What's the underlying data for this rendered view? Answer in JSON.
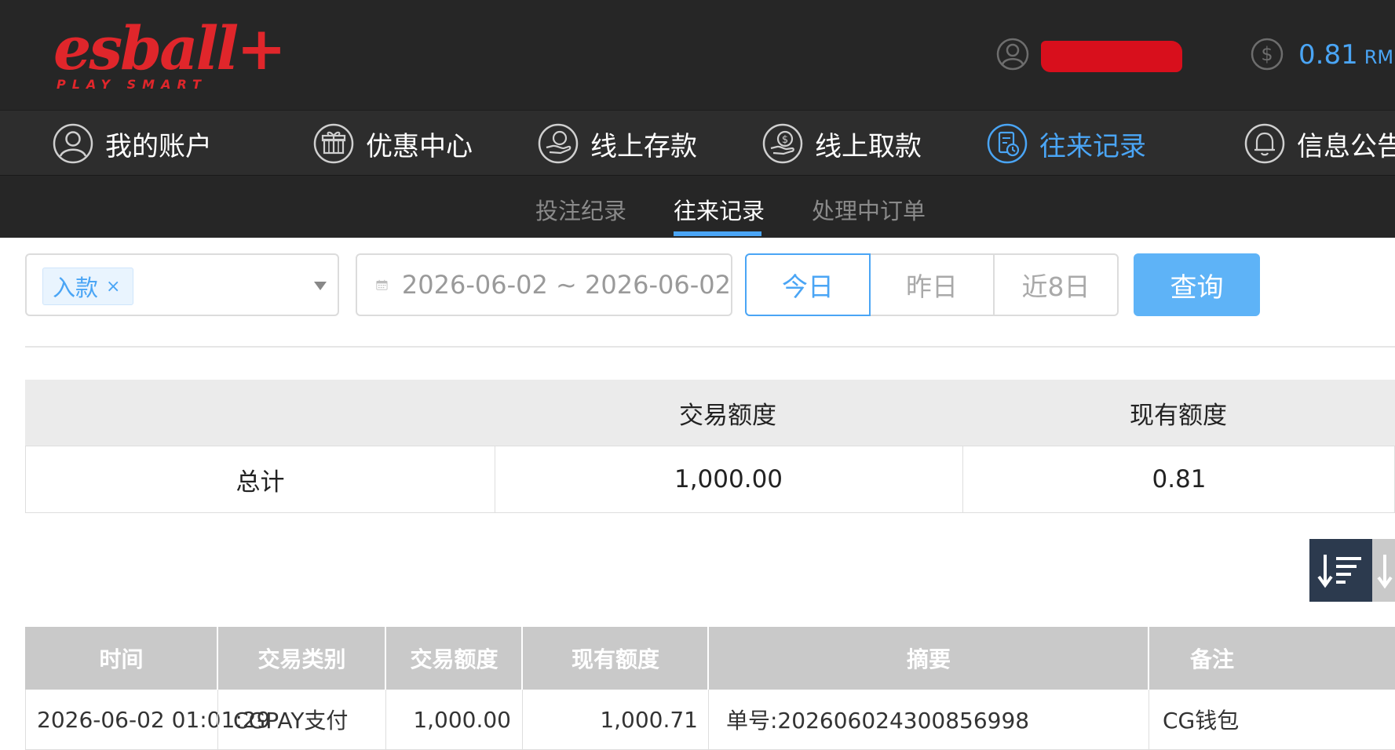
{
  "header": {
    "logo_text": "esball+",
    "logo_tagline": "PLAY SMART",
    "balance_value": "0.81",
    "balance_currency": "RMB"
  },
  "nav": [
    {
      "label": "我的账户",
      "icon": "user-circle-icon"
    },
    {
      "label": "优惠中心",
      "icon": "gift-icon"
    },
    {
      "label": "线上存款",
      "icon": "deposit-icon"
    },
    {
      "label": "线上取款",
      "icon": "withdraw-icon"
    },
    {
      "label": "往来记录",
      "icon": "records-icon",
      "active": true
    },
    {
      "label": "信息公告",
      "icon": "bell-icon"
    }
  ],
  "subnav": [
    {
      "label": "投注纪录"
    },
    {
      "label": "往来记录",
      "active": true
    },
    {
      "label": "处理中订单"
    }
  ],
  "filter": {
    "type_tag": "入款",
    "tag_close": "×",
    "date_range": "2026-06-02 ~ 2026-06-02",
    "quick_ranges": [
      "今日",
      "昨日",
      "近8日"
    ],
    "query_label": "查询"
  },
  "summary": {
    "headers": [
      "",
      "交易额度",
      "现有额度"
    ],
    "row": {
      "label": "总计",
      "amount": "1,000.00",
      "balance": "0.81"
    }
  },
  "records": {
    "headers": [
      "时间",
      "交易类别",
      "交易额度",
      "现有额度",
      "摘要",
      "备注"
    ],
    "rows": [
      {
        "time": "2026-06-02 01:01:29",
        "type": "CGPAY支付",
        "amount": "1,000.00",
        "balance": "1,000.71",
        "summary": "单号:202606024300856998",
        "note": "CG钱包"
      }
    ]
  },
  "colors": {
    "accent": "#4aa5f5",
    "brand": "#e0262b",
    "header_bg": "#262626",
    "sort_button": "#2c3a4e"
  }
}
